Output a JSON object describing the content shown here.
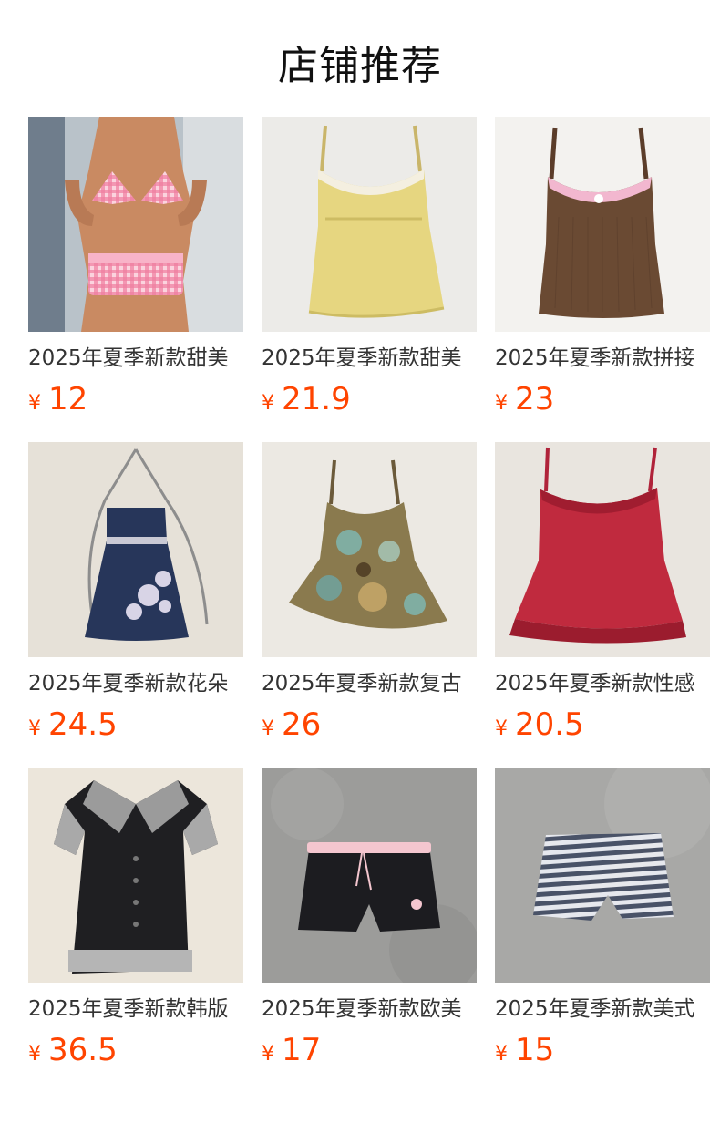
{
  "page": {
    "title": "店铺推荐"
  },
  "products": [
    {
      "title": "2025年夏季新款甜美",
      "currency": "¥",
      "price": "12",
      "image": "pink-gingham-bikini-photo",
      "bg": "#aeb7bf",
      "garment": "#f07ea0"
    },
    {
      "title": "2025年夏季新款甜美",
      "currency": "¥",
      "price": "21.9",
      "image": "yellow-lace-cami-photo",
      "bg": "#ecebe8",
      "garment": "#e6d680"
    },
    {
      "title": "2025年夏季新款拼接",
      "currency": "¥",
      "price": "23",
      "image": "brown-lace-cami-photo",
      "bg": "#f3f2ef",
      "garment": "#6a4a33"
    },
    {
      "title": "2025年夏季新款花朵",
      "currency": "¥",
      "price": "24.5",
      "image": "navy-floral-halter-top-photo",
      "bg": "#e6e1d8",
      "garment": "#27365a"
    },
    {
      "title": "2025年夏季新款复古",
      "currency": "¥",
      "price": "26",
      "image": "floral-print-cami-photo",
      "bg": "#ece9e3",
      "garment": "#8a7a4e"
    },
    {
      "title": "2025年夏季新款性感",
      "currency": "¥",
      "price": "20.5",
      "image": "red-lace-cami-photo",
      "bg": "#e9e5df",
      "garment": "#c02a3e"
    },
    {
      "title": "2025年夏季新款韩版",
      "currency": "¥",
      "price": "36.5",
      "image": "black-plaid-collar-top-photo",
      "bg": "#ece6db",
      "garment": "#1f1f22"
    },
    {
      "title": "2025年夏季新款欧美",
      "currency": "¥",
      "price": "17",
      "image": "black-skull-shorts-photo",
      "bg": "#9c9c9a",
      "garment": "#1c1c20"
    },
    {
      "title": "2025年夏季新款美式",
      "currency": "¥",
      "price": "15",
      "image": "striped-knit-shorts-photo",
      "bg": "#a8a8a6",
      "garment": "#4a5368"
    }
  ]
}
